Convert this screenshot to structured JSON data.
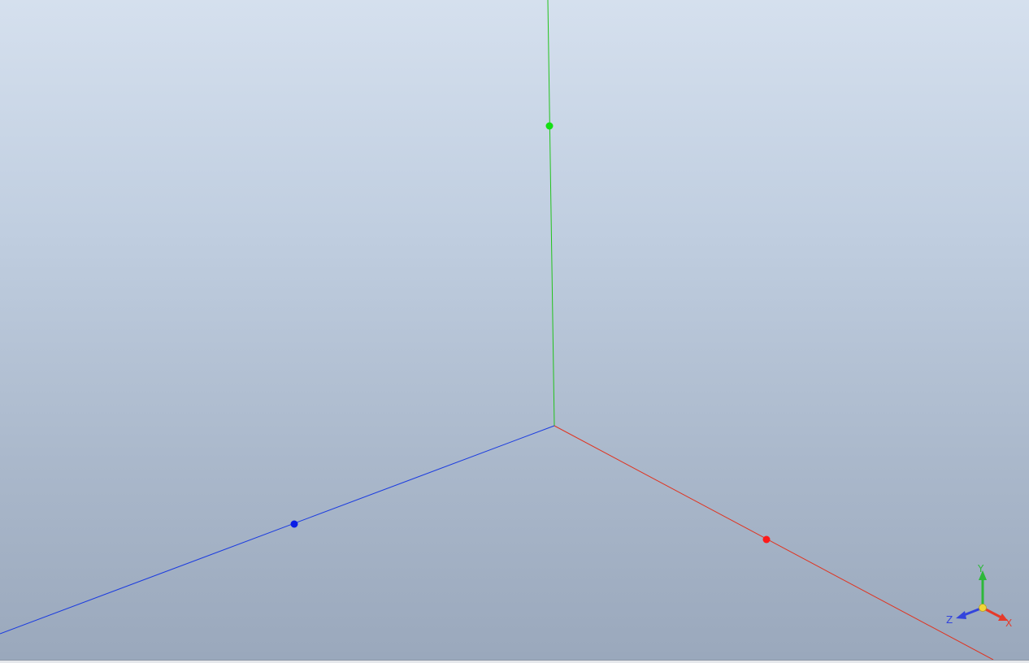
{
  "viewport": {
    "name": "3d-viewport",
    "axes": {
      "x": {
        "color": "#e0331f"
      },
      "y": {
        "color": "#22c21c"
      },
      "z": {
        "color": "#1a3be0"
      }
    },
    "handle_colors": {
      "x": "#ff1a1a",
      "y": "#14e014",
      "z": "#0a1ee6"
    }
  },
  "triad": {
    "labels": {
      "x": "X",
      "y": "Y",
      "z": "Z"
    },
    "colors": {
      "x": "#e53a2a",
      "y": "#2db83a",
      "z": "#3344dd",
      "center": "#f2d43a"
    }
  }
}
